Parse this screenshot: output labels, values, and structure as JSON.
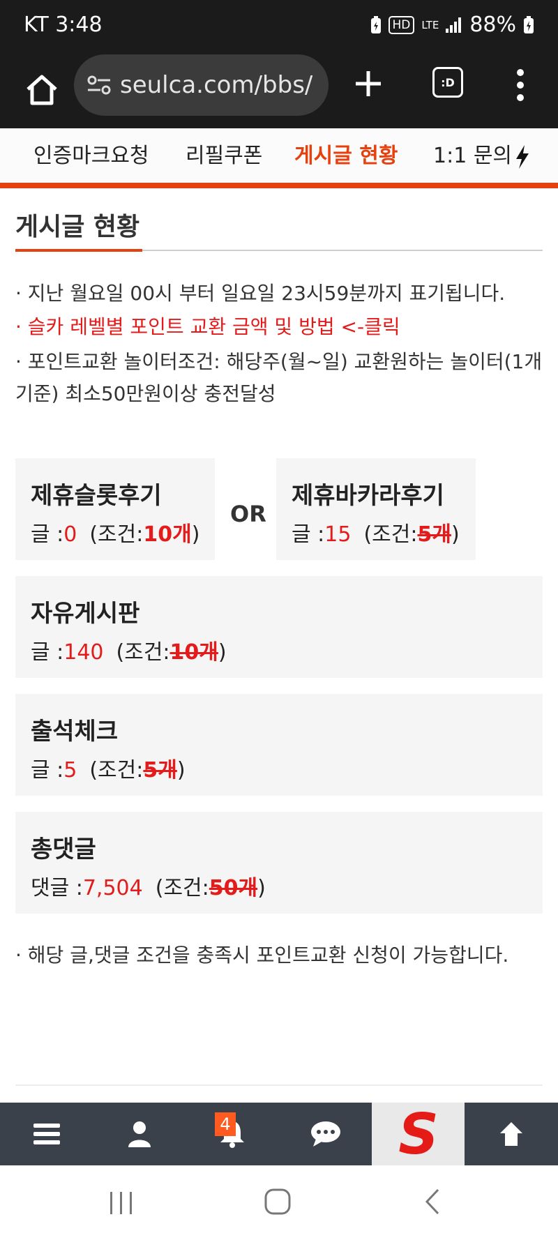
{
  "status_bar": {
    "time": "KT 3:48",
    "battery": "88%",
    "icons": [
      "battery-saver-icon",
      "hd-icon",
      "lte-icon",
      "signal-icon",
      "battery-icon"
    ],
    "hd_label": "HD",
    "lte_label": "LTE"
  },
  "browser": {
    "url": "seulca.com/bbs/",
    "tabs_label": ":D",
    "icons": [
      "home-icon",
      "site-settings-icon",
      "new-tab-icon",
      "tabs-icon",
      "more-menu-icon"
    ]
  },
  "top_nav": {
    "items": [
      {
        "label": "인증마크요청"
      },
      {
        "label": "리필쿠폰"
      },
      {
        "label": "게시글 현황",
        "active": true
      },
      {
        "label": "1:1 문의"
      }
    ],
    "accent_color": "#e5410f"
  },
  "section": {
    "title": "게시글 현황",
    "notes": [
      "· 지난 월요일 00시 부터 일요일 23시59분까지 표기됩니다.",
      "· 슬카 레벨별 포인트 교환 금액 및 방법 <-클릭",
      "· 포인트교환 놀이터조건: 해당주(월~일) 교환원하는 놀이터(1개기준) 최소50만원이상 충전달성"
    ],
    "or_label": "OR"
  },
  "cards": [
    {
      "name": "제휴슬롯후기",
      "count_label": "글 :",
      "count": "0",
      "cond_prefix": "(조건:",
      "requirement": "10개",
      "cond_suffix": ")",
      "met": false
    },
    {
      "name": "제휴바카라후기",
      "count_label": "글 :",
      "count": "15",
      "cond_prefix": "(조건:",
      "requirement": "5개",
      "cond_suffix": ")",
      "met": true
    },
    {
      "name": "자유게시판",
      "count_label": "글 :",
      "count": "140",
      "cond_prefix": "(조건:",
      "requirement": "10개",
      "cond_suffix": ")",
      "met": true
    },
    {
      "name": "출석체크",
      "count_label": "글 :",
      "count": "5",
      "cond_prefix": "(조건:",
      "requirement": "5개",
      "cond_suffix": ")",
      "met": true
    },
    {
      "name": "총댓글",
      "count_label": "댓글 :",
      "count": "7,504",
      "cond_prefix": "(조건:",
      "requirement": "50개",
      "cond_suffix": ")",
      "met": true
    }
  ],
  "footer_note": "· 해당 글,댓글 조건을 충족시 포인트교환 신청이 가능합니다.",
  "bottom_bar": {
    "items": [
      "menu-icon",
      "user-icon",
      "bell-icon",
      "chat-icon",
      "site-logo",
      "scroll-top-icon"
    ],
    "notification_count": "4",
    "logo_letter": "S",
    "logo_color": "#e41b17"
  },
  "system_nav": [
    "recent-apps-icon",
    "home-circle-icon",
    "back-icon"
  ]
}
